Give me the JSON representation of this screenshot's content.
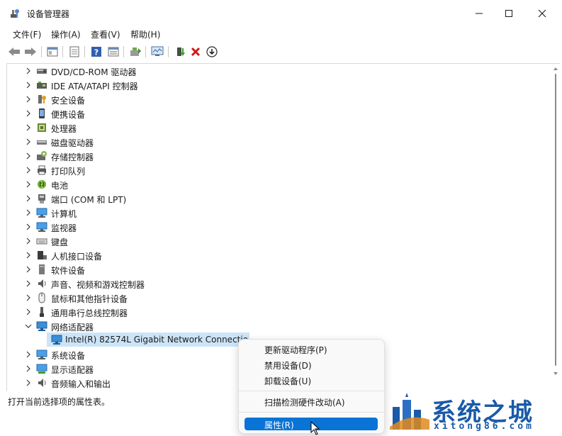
{
  "window": {
    "title": "设备管理器"
  },
  "menubar": {
    "items": [
      "文件(F)",
      "操作(A)",
      "查看(V)",
      "帮助(H)"
    ]
  },
  "toolbar": {
    "icons": [
      "back-icon",
      "forward-icon",
      "show-hide-tree-icon",
      "properties-icon",
      "help-icon",
      "view-icon",
      "update-driver-icon",
      "scan-hardware-icon",
      "enable-device-icon",
      "uninstall-icon",
      "download-icon"
    ]
  },
  "tree": {
    "categories": [
      {
        "label": "DVD/CD-ROM 驱动器",
        "icon": "dvd-drive-icon"
      },
      {
        "label": "IDE ATA/ATAPI 控制器",
        "icon": "ide-controller-icon"
      },
      {
        "label": "安全设备",
        "icon": "security-device-icon"
      },
      {
        "label": "便携设备",
        "icon": "portable-device-icon"
      },
      {
        "label": "处理器",
        "icon": "processor-icon"
      },
      {
        "label": "磁盘驱动器",
        "icon": "disk-drive-icon"
      },
      {
        "label": "存储控制器",
        "icon": "storage-controller-icon"
      },
      {
        "label": "打印队列",
        "icon": "print-queue-icon"
      },
      {
        "label": "电池",
        "icon": "battery-icon"
      },
      {
        "label": "端口 (COM 和 LPT)",
        "icon": "port-icon"
      },
      {
        "label": "计算机",
        "icon": "computer-icon"
      },
      {
        "label": "监视器",
        "icon": "monitor-icon"
      },
      {
        "label": "键盘",
        "icon": "keyboard-icon"
      },
      {
        "label": "人机接口设备",
        "icon": "hid-icon"
      },
      {
        "label": "软件设备",
        "icon": "software-device-icon"
      },
      {
        "label": "声音、视频和游戏控制器",
        "icon": "sound-icon"
      },
      {
        "label": "鼠标和其他指针设备",
        "icon": "mouse-icon"
      },
      {
        "label": "通用串行总线控制器",
        "icon": "usb-icon"
      },
      {
        "label": "网络适配器",
        "icon": "network-adapter-icon",
        "expanded": true
      },
      {
        "label": "系统设备",
        "icon": "system-device-icon"
      },
      {
        "label": "显示适配器",
        "icon": "display-adapter-icon"
      },
      {
        "label": "音频输入和输出",
        "icon": "audio-io-icon"
      }
    ],
    "network_child": "Intel(R) 82574L Gigabit Network Connectio"
  },
  "status_bar": {
    "text": "打开当前选择项的属性表。"
  },
  "context_menu": {
    "items": [
      "更新驱动程序(P)",
      "禁用设备(D)",
      "卸载设备(U)",
      "扫描检测硬件改动(A)",
      "属性(R)"
    ],
    "highlighted": "属性(R)"
  },
  "watermark": {
    "brand": "系统之城",
    "url": "xitong86.com"
  },
  "colors": {
    "selection": "#cce4f7",
    "menu_highlight": "#0a73d6",
    "accent": "#1a5aa8",
    "close_red": "#e81123"
  }
}
